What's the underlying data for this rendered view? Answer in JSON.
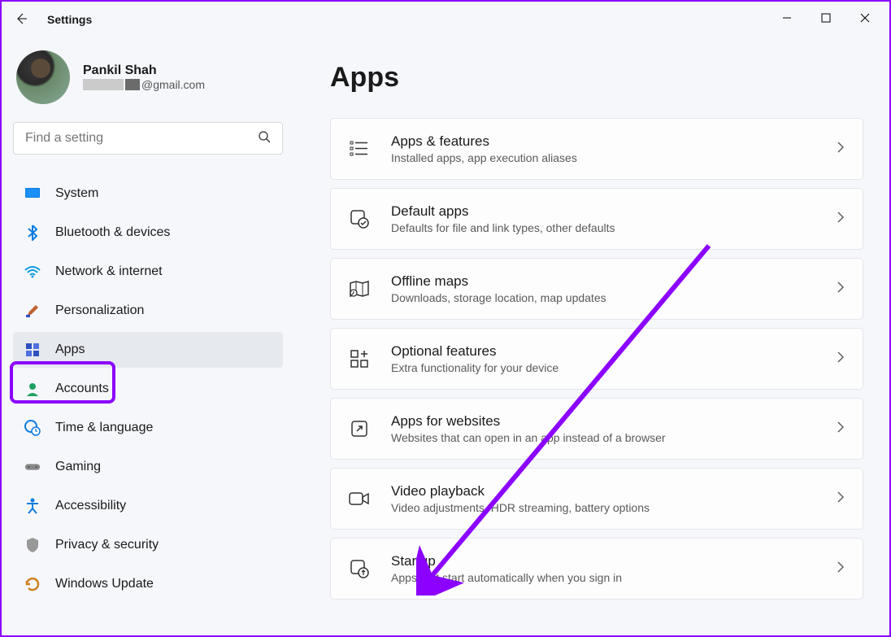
{
  "window": {
    "title": "Settings"
  },
  "profile": {
    "name": "Pankil Shah",
    "email_domain": "@gmail.com"
  },
  "search": {
    "placeholder": "Find a setting"
  },
  "nav": {
    "items": [
      {
        "id": "system",
        "label": "System",
        "icon": "monitor"
      },
      {
        "id": "bluetooth",
        "label": "Bluetooth & devices",
        "icon": "bluetooth"
      },
      {
        "id": "network",
        "label": "Network & internet",
        "icon": "wifi"
      },
      {
        "id": "personalization",
        "label": "Personalization",
        "icon": "brush"
      },
      {
        "id": "apps",
        "label": "Apps",
        "icon": "apps",
        "active": true
      },
      {
        "id": "accounts",
        "label": "Accounts",
        "icon": "person"
      },
      {
        "id": "time",
        "label": "Time & language",
        "icon": "globe-clock"
      },
      {
        "id": "gaming",
        "label": "Gaming",
        "icon": "gamepad"
      },
      {
        "id": "accessibility",
        "label": "Accessibility",
        "icon": "accessibility"
      },
      {
        "id": "privacy",
        "label": "Privacy & security",
        "icon": "shield"
      },
      {
        "id": "update",
        "label": "Windows Update",
        "icon": "refresh"
      }
    ]
  },
  "page": {
    "title": "Apps"
  },
  "cards": [
    {
      "id": "apps-features",
      "title": "Apps & features",
      "desc": "Installed apps, app execution aliases",
      "icon": "list"
    },
    {
      "id": "default-apps",
      "title": "Default apps",
      "desc": "Defaults for file and link types, other defaults",
      "icon": "app-check"
    },
    {
      "id": "offline-maps",
      "title": "Offline maps",
      "desc": "Downloads, storage location, map updates",
      "icon": "map"
    },
    {
      "id": "optional-features",
      "title": "Optional features",
      "desc": "Extra functionality for your device",
      "icon": "grid-plus"
    },
    {
      "id": "apps-websites",
      "title": "Apps for websites",
      "desc": "Websites that can open in an app instead of a browser",
      "icon": "launch"
    },
    {
      "id": "video-playback",
      "title": "Video playback",
      "desc": "Video adjustments, HDR streaming, battery options",
      "icon": "video"
    },
    {
      "id": "startup",
      "title": "Startup",
      "desc": "Apps that start automatically when you sign in",
      "icon": "app-arrow"
    }
  ]
}
